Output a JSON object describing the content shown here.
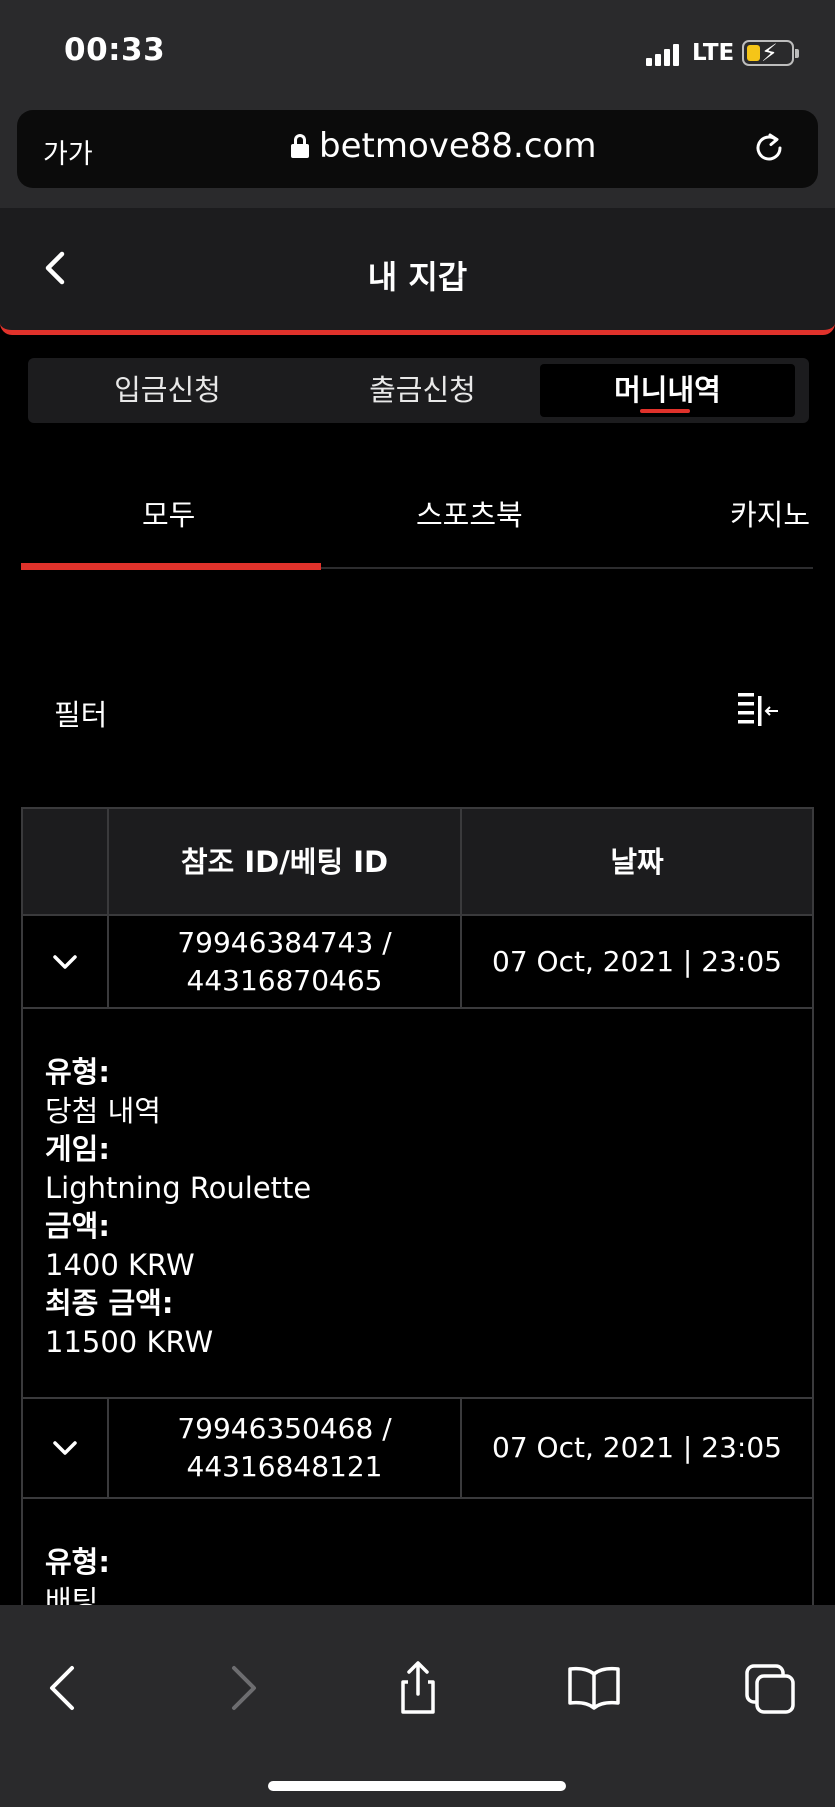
{
  "status_bar": {
    "time": "00:33",
    "network": "LTE"
  },
  "browser": {
    "text_size_label": "가가",
    "domain": "betmove88.com"
  },
  "header": {
    "title": "내 지갑"
  },
  "segments": [
    {
      "label": "입금신청",
      "active": false
    },
    {
      "label": "출금신청",
      "active": false
    },
    {
      "label": "머니내역",
      "active": true
    }
  ],
  "categories": [
    {
      "label": "모두",
      "active": true
    },
    {
      "label": "스포츠북",
      "active": false
    },
    {
      "label": "카지노",
      "active": false
    }
  ],
  "filter": {
    "label": "필터"
  },
  "table": {
    "headers": [
      "",
      "참조 ID/베팅 ID",
      "날짜"
    ],
    "rows": [
      {
        "ref_line1": "79946384743 /",
        "ref_line2": "44316870465",
        "date": "07 Oct, 2021 | 23:05",
        "details": {
          "type_label": "유형:",
          "type_value": "당첨 내역",
          "game_label": "게임:",
          "game_value": "Lightning Roulette",
          "amount_label": "금액:",
          "amount_value": "1400 KRW",
          "final_label": "최종 금액:",
          "final_value": "11500 KRW"
        }
      },
      {
        "ref_line1": "79946350468 /",
        "ref_line2": "44316848121",
        "date": "07 Oct, 2021 | 23:05",
        "details": {
          "type_label": "유형:",
          "type_value": "배팅"
        }
      }
    ]
  },
  "colors": {
    "accent": "#e0322b",
    "background": "#000000",
    "panel": "#1c1c1e",
    "chrome": "#2a2a2c"
  }
}
